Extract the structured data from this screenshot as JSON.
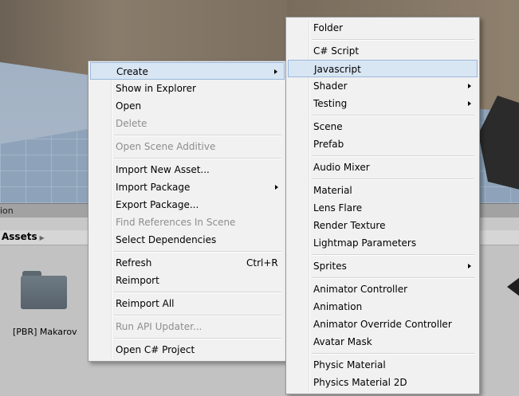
{
  "panel": {
    "tab_label": "ion",
    "breadcrumb": "Assets",
    "asset_label": "[PBR] Makarov"
  },
  "context_menu": {
    "items": [
      {
        "label": "Create",
        "submenu": true,
        "highlighted": true
      },
      {
        "label": "Show in Explorer"
      },
      {
        "label": "Open"
      },
      {
        "label": "Delete",
        "disabled": true
      },
      {
        "label": "Open Scene Additive",
        "disabled": true
      },
      {
        "label": "Import New Asset..."
      },
      {
        "label": "Import Package",
        "submenu": true
      },
      {
        "label": "Export Package..."
      },
      {
        "label": "Find References In Scene",
        "disabled": true
      },
      {
        "label": "Select Dependencies"
      },
      {
        "label": "Refresh",
        "shortcut": "Ctrl+R"
      },
      {
        "label": "Reimport"
      },
      {
        "label": "Reimport All"
      },
      {
        "label": "Run API Updater...",
        "disabled": true
      },
      {
        "label": "Open C# Project"
      }
    ]
  },
  "create_submenu": {
    "items": [
      {
        "label": "Folder"
      },
      {
        "label": "C# Script"
      },
      {
        "label": "Javascript",
        "highlighted": true
      },
      {
        "label": "Shader",
        "submenu": true
      },
      {
        "label": "Testing",
        "submenu": true
      },
      {
        "label": "Scene"
      },
      {
        "label": "Prefab"
      },
      {
        "label": "Audio Mixer"
      },
      {
        "label": "Material"
      },
      {
        "label": "Lens Flare"
      },
      {
        "label": "Render Texture"
      },
      {
        "label": "Lightmap Parameters"
      },
      {
        "label": "Sprites",
        "submenu": true
      },
      {
        "label": "Animator Controller"
      },
      {
        "label": "Animation"
      },
      {
        "label": "Animator Override Controller"
      },
      {
        "label": "Avatar Mask"
      },
      {
        "label": "Physic Material"
      },
      {
        "label": "Physics Material 2D"
      }
    ]
  },
  "colors": {
    "menu_bg": "#f1f1f1",
    "highlight_bg": "#d8e5f3",
    "highlight_border": "#9ab8db",
    "disabled_text": "#8d8d8d"
  },
  "icons": [
    "submenu-arrow-icon",
    "folder-icon",
    "breadcrumb-arrow-icon"
  ]
}
